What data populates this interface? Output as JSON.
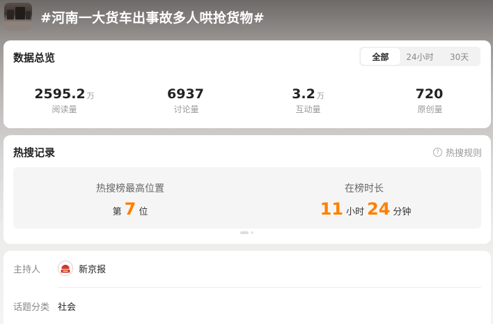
{
  "header": {
    "title": "#河南一大货车出事故多人哄抢货物#",
    "thumbnail_icon": "topic-thumbnail"
  },
  "overview": {
    "title": "数据总览",
    "tabs": [
      {
        "label": "全部",
        "active": true
      },
      {
        "label": "24小时",
        "active": false
      },
      {
        "label": "30天",
        "active": false
      }
    ],
    "stats": [
      {
        "value": "2595.2",
        "unit": "万",
        "label": "阅读量"
      },
      {
        "value": "6937",
        "unit": "",
        "label": "讨论量"
      },
      {
        "value": "3.2",
        "unit": "万",
        "label": "互动量"
      },
      {
        "value": "720",
        "unit": "",
        "label": "原创量"
      }
    ]
  },
  "hot": {
    "title": "热搜记录",
    "rules_label": "热搜规则",
    "rules_icon": "question-circle-icon",
    "peak": {
      "label": "热搜榜最高位置",
      "prefix": "第",
      "rank": "7",
      "suffix": "位"
    },
    "duration": {
      "label": "在榜时长",
      "hours": "11",
      "hours_unit": "小时",
      "minutes": "24",
      "minutes_unit": "分钟"
    }
  },
  "info": {
    "host_label": "主持人",
    "host_name": "新京报",
    "host_avatar_icon": "xinjingbao-logo",
    "category_label": "话题分类",
    "category_value": "社会"
  },
  "colors": {
    "accent": "#ff7f00",
    "text": "#222222",
    "muted": "#999999"
  }
}
